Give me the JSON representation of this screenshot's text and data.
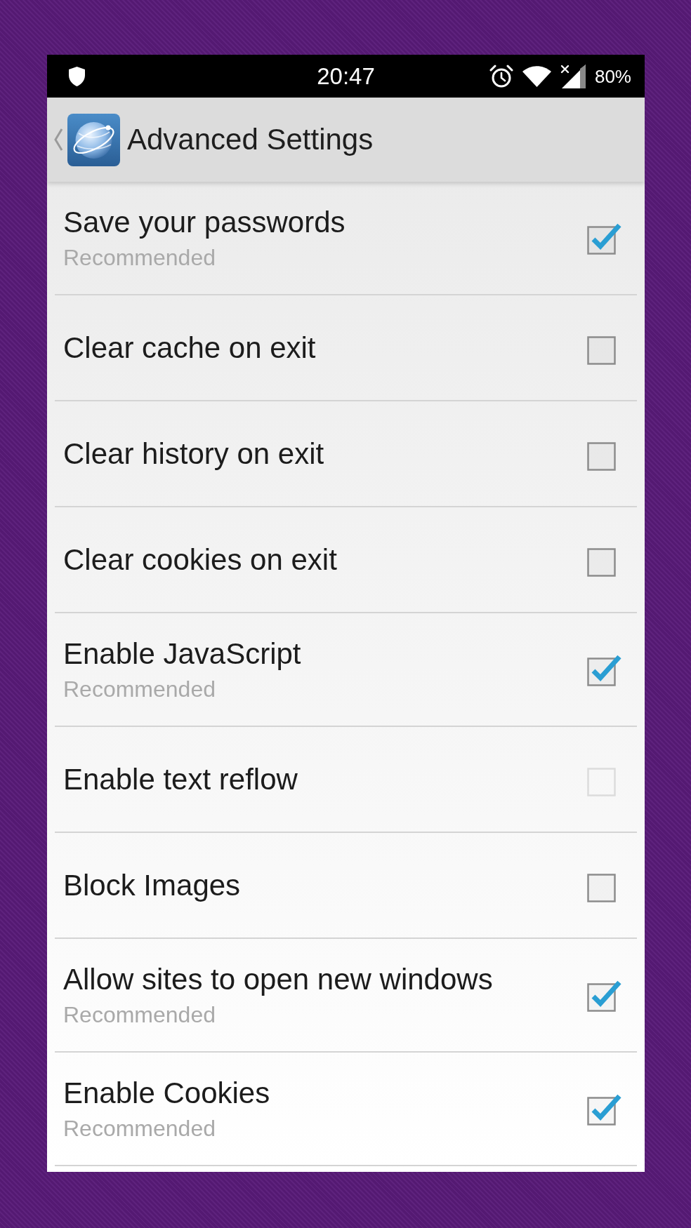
{
  "status_bar": {
    "time": "20:47",
    "battery": "80%"
  },
  "header": {
    "title": "Advanced Settings"
  },
  "settings": [
    {
      "title": "Save your passwords",
      "subtitle": "Recommended",
      "checked": true,
      "disabled": false
    },
    {
      "title": "Clear cache on exit",
      "checked": false,
      "disabled": false
    },
    {
      "title": "Clear history on exit",
      "checked": false,
      "disabled": false
    },
    {
      "title": "Clear cookies on exit",
      "checked": false,
      "disabled": false
    },
    {
      "title": "Enable JavaScript",
      "subtitle": "Recommended",
      "checked": true,
      "disabled": false
    },
    {
      "title": "Enable text reflow",
      "checked": false,
      "disabled": true
    },
    {
      "title": "Block Images",
      "checked": false,
      "disabled": false
    },
    {
      "title": "Allow sites to open new windows",
      "subtitle": "Recommended",
      "checked": true,
      "disabled": false
    },
    {
      "title": "Enable Cookies",
      "subtitle": "Recommended",
      "checked": true,
      "disabled": false
    }
  ]
}
